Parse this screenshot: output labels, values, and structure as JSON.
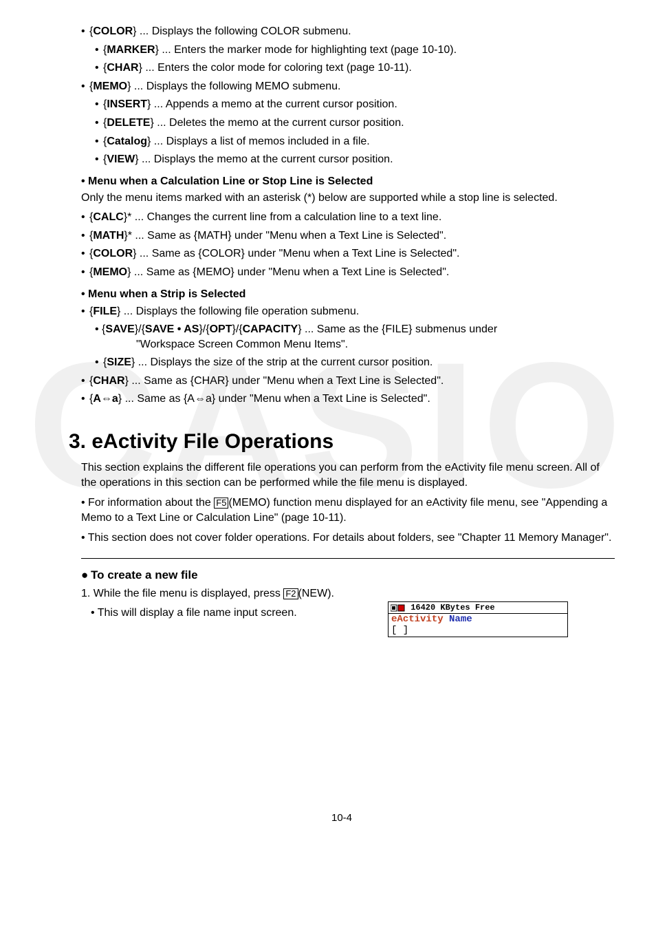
{
  "watermark": "CASIO",
  "top_items": [
    {
      "label": "COLOR",
      "text": " ... Displays the following COLOR submenu."
    },
    {
      "sub": [
        {
          "label": "MARKER",
          "text": " ... Enters the marker mode for highlighting text (page 10-10)."
        },
        {
          "label": "CHAR",
          "text": " ... Enters the color mode for coloring text (page 10-11)."
        }
      ]
    },
    {
      "label": "MEMO",
      "text": " ... Displays the following MEMO submenu."
    },
    {
      "sub": [
        {
          "label": "INSERT",
          "text": " ... Appends a memo at the current cursor position."
        },
        {
          "label": "DELETE",
          "text": " ... Deletes the memo at the current cursor position."
        },
        {
          "label": "Catalog",
          "text": " ... Displays a list of memos included in a file."
        },
        {
          "label": "VIEW",
          "text": " ... Displays the memo at the current cursor position."
        }
      ]
    }
  ],
  "sec1_title": "• Menu when a Calculation Line or Stop Line is Selected",
  "sec1_intro": "Only the menu items marked with an asterisk (*) below are supported while a stop line is selected.",
  "sec1_items": [
    {
      "label": "CALC",
      "suffix": "}* ... Changes the current line from a calculation line to a text line."
    },
    {
      "label": "MATH",
      "suffix": "}* ... Same as {MATH} under \"Menu when a Text Line is Selected\"."
    },
    {
      "label": "COLOR",
      "suffix": "} ... Same as {COLOR} under \"Menu when a Text Line is Selected\"."
    },
    {
      "label": "MEMO",
      "suffix": "} ... Same as {MEMO} under \"Menu when a Text Line is Selected\"."
    }
  ],
  "sec2_title": "• Menu when a Strip is Selected",
  "sec2_file": {
    "label": "FILE",
    "text": " ... Displays the following file operation submenu."
  },
  "sec2_save_line": {
    "pre": "• {",
    "p1": "SAVE",
    "s1": "}/{",
    "p2": "SAVE • AS",
    "s2": "}/{",
    "p3": "OPT",
    "s3": "}/{",
    "p4": "CAPACITY",
    "post": "} ... Same as the {FILE} submenus under",
    "cont": "\"Workspace Screen Common Menu Items\"."
  },
  "sec2_size": {
    "label": "SIZE",
    "text": " ... Displays the size of the strip at the current cursor position."
  },
  "sec2_char": {
    "label": "CHAR",
    "text": " ... Same as {CHAR} under \"Menu when a Text Line is Selected\"."
  },
  "sec2_aa": {
    "label": "A⇔a",
    "text": " ... Same as {A⇔a} under \"Menu when a Text Line is Selected\"."
  },
  "big_title": "3. eActivity File Operations",
  "big_intro": "This section explains the different file operations you can perform from the eActivity file menu screen. All of the operations in this section can be performed while the file menu is displayed.",
  "f5_pre": "• For information about the ",
  "f5_key": "F5",
  "f5_post": "(MEMO) function menu displayed for an eActivity file menu, see \"Appending a Memo to a Text Line or Calculation Line\" (page 10-11).",
  "big_p2": "• This section does not cover folder operations. For details about folders, see \"Chapter 11 Memory Manager\".",
  "create_title": "To create a new file",
  "create_step_pre": "1. While the file menu is displayed, press ",
  "create_step_key": "F2",
  "create_step_post": "(NEW).",
  "create_sub": "• This will display a file name input screen.",
  "calc": {
    "header": "  16420 KBytes Free",
    "line1a": "eActivity",
    "line1b": " Name",
    "line2": "[          ]"
  },
  "page_num": "10-4"
}
